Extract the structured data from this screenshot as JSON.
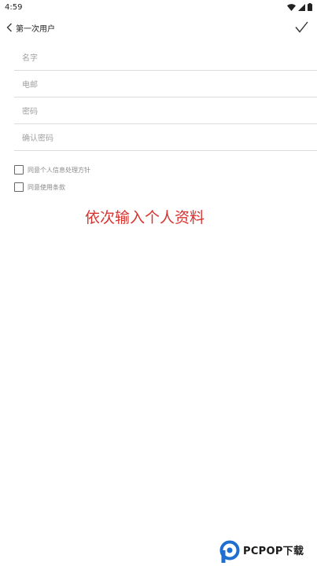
{
  "status_bar": {
    "time": "4:59",
    "icons": [
      "wifi-icon",
      "signal-icon",
      "battery-icon"
    ]
  },
  "app_bar": {
    "title": "第一次用户",
    "back_icon": "chevron-left-icon",
    "confirm_icon": "checkmark-icon"
  },
  "form": {
    "fields": [
      {
        "name": "name",
        "placeholder": "名字",
        "value": ""
      },
      {
        "name": "email",
        "placeholder": "电邮",
        "value": ""
      },
      {
        "name": "password",
        "placeholder": "密码",
        "value": ""
      },
      {
        "name": "confirm_password",
        "placeholder": "确认密码",
        "value": ""
      }
    ],
    "checkboxes": [
      {
        "label": "同意个人信息处理方针",
        "checked": false
      },
      {
        "label": "同意使用条款",
        "checked": false
      }
    ]
  },
  "hint": "依次输入个人资料",
  "watermark": {
    "text": "PCPOP下载"
  },
  "colors": {
    "hint": "#d9322e",
    "divider": "#dcdcdc",
    "placeholder": "#a0a0a0",
    "watermark_blue": "#1e6fd0"
  }
}
